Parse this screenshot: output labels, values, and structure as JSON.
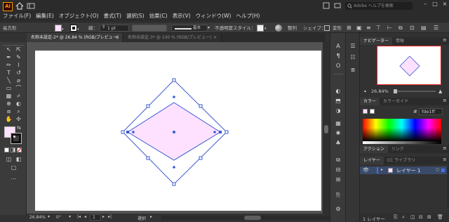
{
  "app": {
    "logo": "Ai"
  },
  "menu": [
    "ファイル(F)",
    "編集(E)",
    "オブジェクト(O)",
    "書式(T)",
    "選択(S)",
    "効果(C)",
    "表示(V)",
    "ウィンドウ(W)",
    "ヘルプ(H)"
  ],
  "search": {
    "placeholder": "Adobe ヘルプを検索"
  },
  "controlbar": {
    "object_type": "長方形",
    "fill_color": "#fde1ff",
    "stroke_label": "線：",
    "stroke_width": "1 pt",
    "brush_label": "基本",
    "opacity_label": "不透明度",
    "style_label": "スタイル：",
    "align_label": "整列",
    "shape_label": "シェイプ：",
    "transform_label": "変形"
  },
  "tabs": [
    {
      "label": "名称未設定-2* @ 26.84 % (RGB/プレビュー)",
      "close": "×",
      "active": true
    },
    {
      "label": "名称未設定-3* @ 100 % (RGB/プレビュー)",
      "close": "×",
      "active": false
    }
  ],
  "status": {
    "zoom": "26.84%",
    "rotation": "0°",
    "page": "1",
    "tool": "選択"
  },
  "navigator": {
    "tabs": [
      "ナビゲーター",
      "情報"
    ],
    "zoom": "26.84%"
  },
  "color_panel": {
    "tabs": [
      "カラー",
      "カラーガイド"
    ],
    "hex_prefix": "#",
    "hex": "fde1ff"
  },
  "actions_panel": {
    "tabs": [
      "アクション",
      "リンク"
    ]
  },
  "layers_panel": {
    "tabs": [
      "レイヤー",
      "CC ライブラリ"
    ],
    "layer_name": "レイヤー 1",
    "footer": "1 レイヤー"
  },
  "colors": {
    "accent": "#4a6fdc",
    "selection": "#3a5bd0",
    "fill": "#fde1ff",
    "artboard": "#ffffff",
    "pasteboard": "#535353"
  }
}
